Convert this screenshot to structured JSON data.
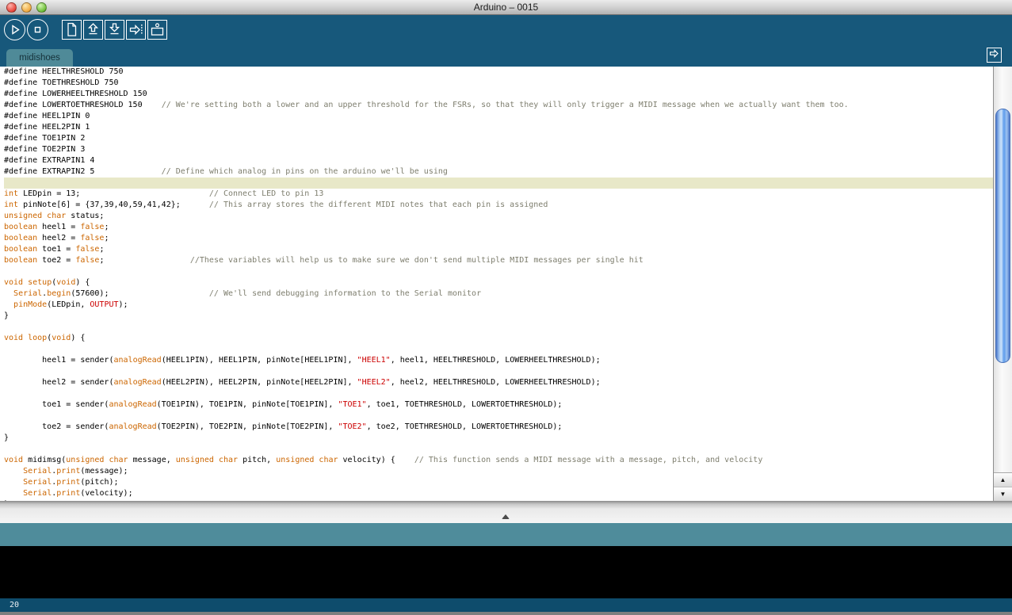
{
  "window": {
    "title": "Arduino – 0015",
    "traffic_lights": [
      "close",
      "minimize",
      "zoom"
    ]
  },
  "toolbar": {
    "buttons": [
      {
        "name": "verify",
        "icon": "play-icon"
      },
      {
        "name": "stop",
        "icon": "stop-icon"
      },
      {
        "name": "new-sketch",
        "icon": "page-icon"
      },
      {
        "name": "open",
        "icon": "arrow-up-icon"
      },
      {
        "name": "save",
        "icon": "arrow-down-icon"
      },
      {
        "name": "upload",
        "icon": "arrow-right-dotted-icon"
      },
      {
        "name": "serial-monitor",
        "icon": "monitor-antenna-icon"
      }
    ]
  },
  "tabbar": {
    "active_tab": "midishoes",
    "tab_menu_icon": "arrow-right-box-icon"
  },
  "editor": {
    "highlighted_row": 10,
    "lines": [
      [
        [
          "p",
          "#define HEELTHRESHOLD 750"
        ]
      ],
      [
        [
          "p",
          "#define TOETHRESHOLD 750"
        ]
      ],
      [
        [
          "p",
          "#define LOWERHEELTHRESHOLD 150"
        ]
      ],
      [
        [
          "p",
          "#define LOWERTOETHRESHOLD 150"
        ],
        [
          "c",
          "    // We're setting both a lower and an upper threshold for the FSRs, so that they will only trigger a MIDI message when we actually want them too."
        ]
      ],
      [
        [
          "p",
          "#define HEEL1PIN 0"
        ]
      ],
      [
        [
          "p",
          "#define HEEL2PIN 1"
        ]
      ],
      [
        [
          "p",
          "#define TOE1PIN 2"
        ]
      ],
      [
        [
          "p",
          "#define TOE2PIN 3"
        ]
      ],
      [
        [
          "p",
          "#define EXTRAPIN1 4"
        ]
      ],
      [
        [
          "p",
          "#define EXTRAPIN2 5"
        ],
        [
          "c",
          "              // Define which analog in pins on the arduino we'll be using"
        ]
      ],
      [],
      [
        [
          "k",
          "int"
        ],
        [
          "p",
          " LEDpin = 13;"
        ],
        [
          "c",
          "                           // Connect LED to pin 13"
        ]
      ],
      [
        [
          "k",
          "int"
        ],
        [
          "p",
          " pinNote[6] = {37,39,40,59,41,42};"
        ],
        [
          "c",
          "      // This array stores the different MIDI notes that each pin is assigned"
        ]
      ],
      [
        [
          "k",
          "unsigned char"
        ],
        [
          "p",
          " status;"
        ]
      ],
      [
        [
          "k",
          "boolean"
        ],
        [
          "p",
          " heel1 = "
        ],
        [
          "k",
          "false"
        ],
        [
          "p",
          ";"
        ]
      ],
      [
        [
          "k",
          "boolean"
        ],
        [
          "p",
          " heel2 = "
        ],
        [
          "k",
          "false"
        ],
        [
          "p",
          ";"
        ]
      ],
      [
        [
          "k",
          "boolean"
        ],
        [
          "p",
          " toe1 = "
        ],
        [
          "k",
          "false"
        ],
        [
          "p",
          ";"
        ]
      ],
      [
        [
          "k",
          "boolean"
        ],
        [
          "p",
          " toe2 = "
        ],
        [
          "k",
          "false"
        ],
        [
          "p",
          ";"
        ],
        [
          "c",
          "                  //These variables will help us to make sure we don't send multiple MIDI messages per single hit"
        ]
      ],
      [],
      [
        [
          "k",
          "void"
        ],
        [
          "p",
          " "
        ],
        [
          "k",
          "setup"
        ],
        [
          "p",
          "("
        ],
        [
          "k",
          "void"
        ],
        [
          "p",
          ") {"
        ]
      ],
      [
        [
          "p",
          "  "
        ],
        [
          "k",
          "Serial"
        ],
        [
          "p",
          "."
        ],
        [
          "k",
          "begin"
        ],
        [
          "p",
          "(57600);"
        ],
        [
          "c",
          "                     // We'll send debugging information to the Serial monitor"
        ]
      ],
      [
        [
          "p",
          "  "
        ],
        [
          "k",
          "pinMode"
        ],
        [
          "p",
          "(LEDpin, "
        ],
        [
          "l",
          "OUTPUT"
        ],
        [
          "p",
          ");"
        ]
      ],
      [
        [
          "p",
          "}"
        ]
      ],
      [],
      [
        [
          "k",
          "void"
        ],
        [
          "p",
          " "
        ],
        [
          "k",
          "loop"
        ],
        [
          "p",
          "("
        ],
        [
          "k",
          "void"
        ],
        [
          "p",
          ") {"
        ]
      ],
      [],
      [
        [
          "p",
          "        heel1 = sender("
        ],
        [
          "k",
          "analogRead"
        ],
        [
          "p",
          "(HEEL1PIN), HEEL1PIN, pinNote[HEEL1PIN], "
        ],
        [
          "l",
          "\"HEEL1\""
        ],
        [
          "p",
          ", heel1, HEELTHRESHOLD, LOWERHEELTHRESHOLD);"
        ]
      ],
      [],
      [
        [
          "p",
          "        heel2 = sender("
        ],
        [
          "k",
          "analogRead"
        ],
        [
          "p",
          "(HEEL2PIN), HEEL2PIN, pinNote[HEEL2PIN], "
        ],
        [
          "l",
          "\"HEEL2\""
        ],
        [
          "p",
          ", heel2, HEELTHRESHOLD, LOWERHEELTHRESHOLD);"
        ]
      ],
      [],
      [
        [
          "p",
          "        toe1 = sender("
        ],
        [
          "k",
          "analogRead"
        ],
        [
          "p",
          "(TOE1PIN), TOE1PIN, pinNote[TOE1PIN], "
        ],
        [
          "l",
          "\"TOE1\""
        ],
        [
          "p",
          ", toe1, TOETHRESHOLD, LOWERTOETHRESHOLD);"
        ]
      ],
      [],
      [
        [
          "p",
          "        toe2 = sender("
        ],
        [
          "k",
          "analogRead"
        ],
        [
          "p",
          "(TOE2PIN), TOE2PIN, pinNote[TOE2PIN], "
        ],
        [
          "l",
          "\"TOE2\""
        ],
        [
          "p",
          ", toe2, TOETHRESHOLD, LOWERTOETHRESHOLD);"
        ]
      ],
      [
        [
          "p",
          "}"
        ]
      ],
      [],
      [
        [
          "k",
          "void"
        ],
        [
          "p",
          " midimsg("
        ],
        [
          "k",
          "unsigned char"
        ],
        [
          "p",
          " message, "
        ],
        [
          "k",
          "unsigned char"
        ],
        [
          "p",
          " pitch, "
        ],
        [
          "k",
          "unsigned char"
        ],
        [
          "p",
          " velocity) {"
        ],
        [
          "c",
          "    // This function sends a MIDI message with a message, pitch, and velocity"
        ]
      ],
      [
        [
          "p",
          "    "
        ],
        [
          "k",
          "Serial"
        ],
        [
          "p",
          "."
        ],
        [
          "k",
          "print"
        ],
        [
          "p",
          "(message);"
        ]
      ],
      [
        [
          "p",
          "    "
        ],
        [
          "k",
          "Serial"
        ],
        [
          "p",
          "."
        ],
        [
          "k",
          "print"
        ],
        [
          "p",
          "(pitch);"
        ]
      ],
      [
        [
          "p",
          "    "
        ],
        [
          "k",
          "Serial"
        ],
        [
          "p",
          "."
        ],
        [
          "k",
          "print"
        ],
        [
          "p",
          "(velocity);"
        ]
      ],
      [
        [
          "p",
          "}"
        ]
      ]
    ]
  },
  "statusbar": {
    "line_number": "20"
  },
  "colors": {
    "toolbar_bg": "#17587B",
    "tab_bg": "#4F8A98",
    "status_strip_bg": "#4F8C9B",
    "console_bg": "#000000",
    "line_bar_bg": "#0E4C6C",
    "highlight_line_bg": "#E8E8C8",
    "keyword": "#CC6600",
    "literal": "#CC0000",
    "comment": "#7E7E6E"
  }
}
